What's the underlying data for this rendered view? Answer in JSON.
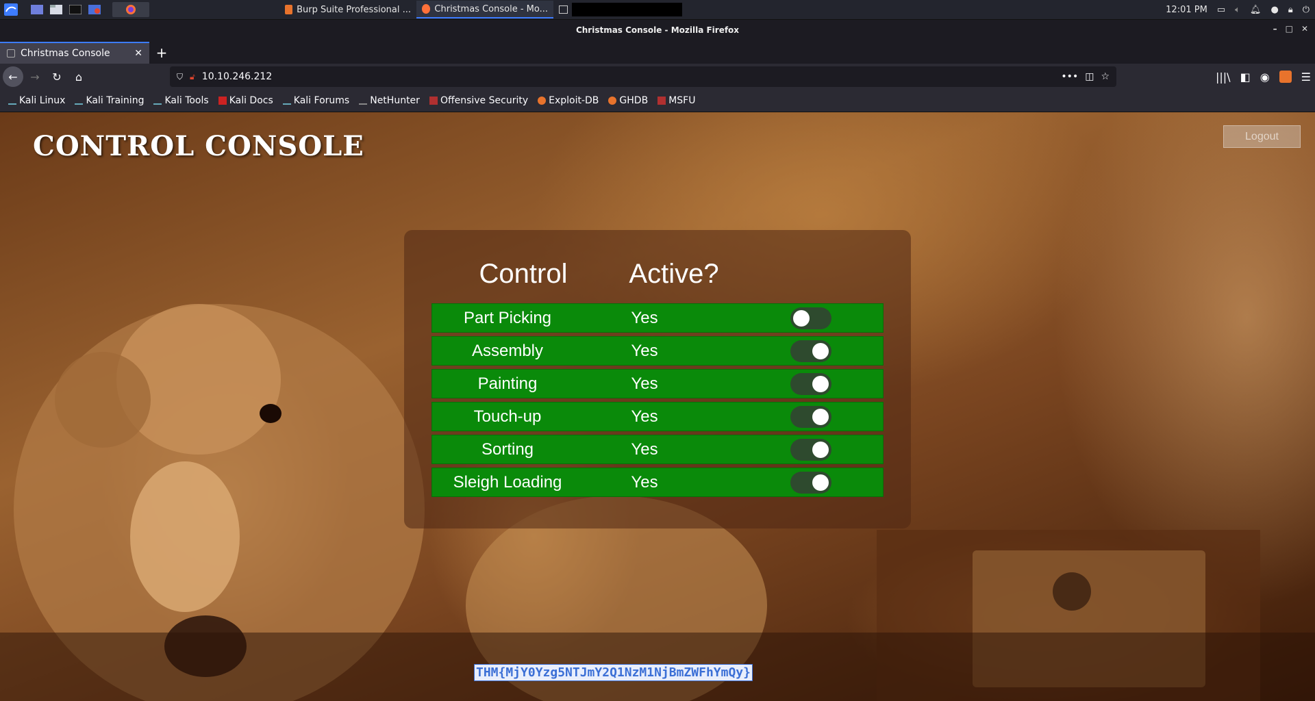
{
  "panel": {
    "tasks": [
      {
        "label": "Burp Suite Professional ..."
      },
      {
        "label": "Christmas Console - Mo..."
      }
    ],
    "clock": "12:01 PM"
  },
  "window": {
    "title": "Christmas Console - Mozilla Firefox"
  },
  "tab": {
    "title": "Christmas Console"
  },
  "urlbar": {
    "url": "10.10.246.212"
  },
  "bookmarks": [
    {
      "label": "Kali Linux"
    },
    {
      "label": "Kali Training"
    },
    {
      "label": "Kali Tools"
    },
    {
      "label": "Kali Docs"
    },
    {
      "label": "Kali Forums"
    },
    {
      "label": "NetHunter"
    },
    {
      "label": "Offensive Security"
    },
    {
      "label": "Exploit-DB"
    },
    {
      "label": "GHDB"
    },
    {
      "label": "MSFU"
    }
  ],
  "page": {
    "title": "CONTROL CONSOLE",
    "logout_label": "Logout",
    "headers": {
      "control": "Control",
      "active": "Active?"
    },
    "rows": [
      {
        "name": "Part Picking",
        "active": "Yes",
        "switch": "off"
      },
      {
        "name": "Assembly",
        "active": "Yes",
        "switch": "on"
      },
      {
        "name": "Painting",
        "active": "Yes",
        "switch": "on"
      },
      {
        "name": "Touch-up",
        "active": "Yes",
        "switch": "on"
      },
      {
        "name": "Sorting",
        "active": "Yes",
        "switch": "on"
      },
      {
        "name": "Sleigh Loading",
        "active": "Yes",
        "switch": "on"
      }
    ],
    "flag_text": "THM{MjY0Yzg5NTJmY2Q1NzM1NjBmZWFhYmQy}"
  },
  "colors": {
    "row_green": "#0a8a0a",
    "accent_blue": "#3d7cff"
  }
}
